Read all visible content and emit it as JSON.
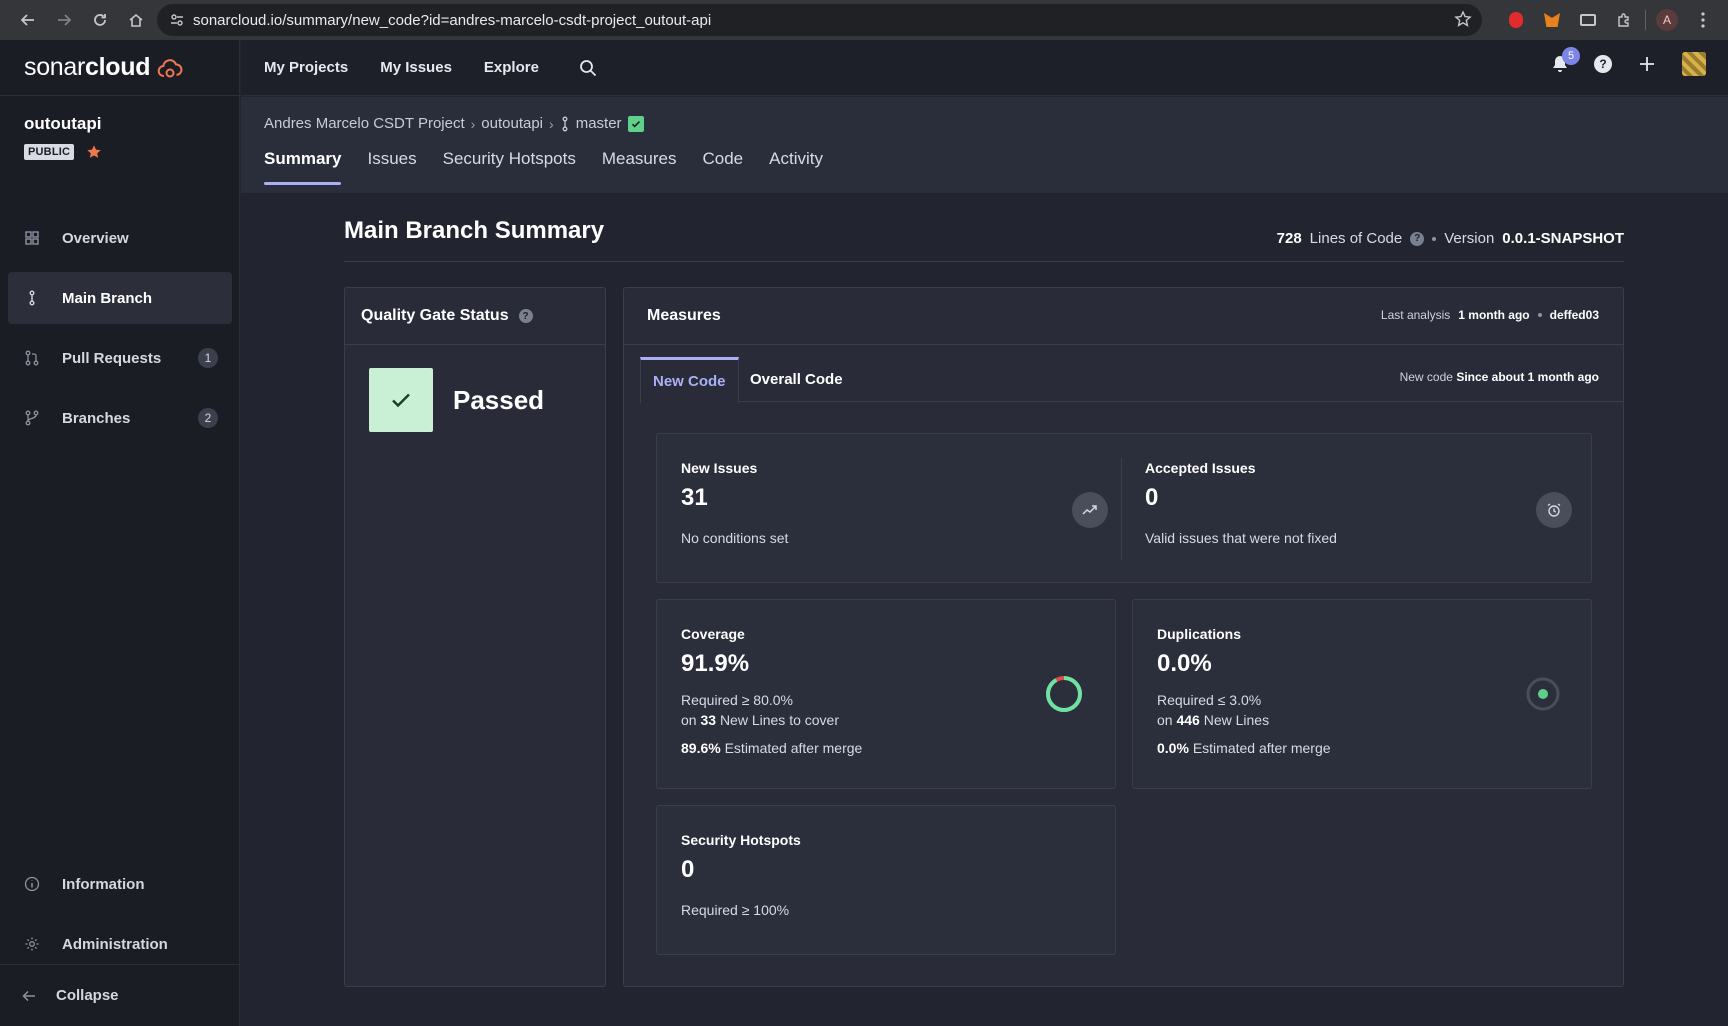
{
  "browser": {
    "url": "sonarcloud.io/summary/new_code?id=andres-marcelo-csdt-project_outout-api",
    "profile_initial": "A"
  },
  "brand": {
    "logo_light": "sonar",
    "logo_bold": "cloud",
    "accent": "#f0764d"
  },
  "sidebar": {
    "project_name": "outoutapi",
    "visibility": "PUBLIC",
    "items": [
      {
        "label": "Overview",
        "icon": "overview-grid-icon"
      },
      {
        "label": "Main Branch",
        "icon": "branch-icon",
        "active": true
      },
      {
        "label": "Pull Requests",
        "icon": "pull-request-icon",
        "count": "1"
      },
      {
        "label": "Branches",
        "icon": "branches-icon",
        "count": "2"
      }
    ],
    "bottom_items": [
      {
        "label": "Information",
        "icon": "info-icon"
      },
      {
        "label": "Administration",
        "icon": "gear-icon"
      }
    ],
    "collapse_label": "Collapse"
  },
  "topbar": {
    "nav": [
      "My Projects",
      "My Issues",
      "Explore"
    ],
    "notification_count": "5"
  },
  "project_header": {
    "breadcrumbs": [
      "Andres Marcelo CSDT Project",
      "outoutapi"
    ],
    "branch": "master",
    "tabs": [
      "Summary",
      "Issues",
      "Security Hotspots",
      "Measures",
      "Code",
      "Activity"
    ],
    "active_tab": "Summary"
  },
  "summary": {
    "title": "Main Branch Summary",
    "loc_value": "728",
    "loc_label": "Lines of Code",
    "version_label": "Version",
    "version_value": "0.0.1-SNAPSHOT"
  },
  "quality_gate": {
    "title": "Quality Gate Status",
    "status": "Passed",
    "status_color": "#c9f0d5"
  },
  "measures": {
    "title": "Measures",
    "last_analysis_label": "Last analysis",
    "last_analysis_value": "1 month ago",
    "commit": "deffed03",
    "tabs": [
      "New Code",
      "Overall Code"
    ],
    "new_code_label": "New code",
    "new_code_value": "Since about 1 month ago",
    "new_issues": {
      "label": "New Issues",
      "value": "31",
      "sub": "No conditions set"
    },
    "accepted_issues": {
      "label": "Accepted Issues",
      "value": "0",
      "sub": "Valid issues that were not fixed"
    },
    "coverage": {
      "label": "Coverage",
      "value": "91.9%",
      "fraction": 0.919,
      "required": "Required ≥ 80.0%",
      "on_prefix": "on",
      "lines": "33",
      "lines_suffix": "New Lines to cover",
      "estimate": "89.6%",
      "estimate_suffix": "Estimated after merge"
    },
    "duplications": {
      "label": "Duplications",
      "value": "0.0%",
      "required": "Required ≤ 3.0%",
      "on_prefix": "on",
      "lines": "446",
      "lines_suffix": "New Lines",
      "estimate": "0.0%",
      "estimate_suffix": "Estimated after merge"
    },
    "security_hotspots": {
      "label": "Security Hotspots",
      "value": "0",
      "sub": "Required ≥ 100%"
    }
  }
}
